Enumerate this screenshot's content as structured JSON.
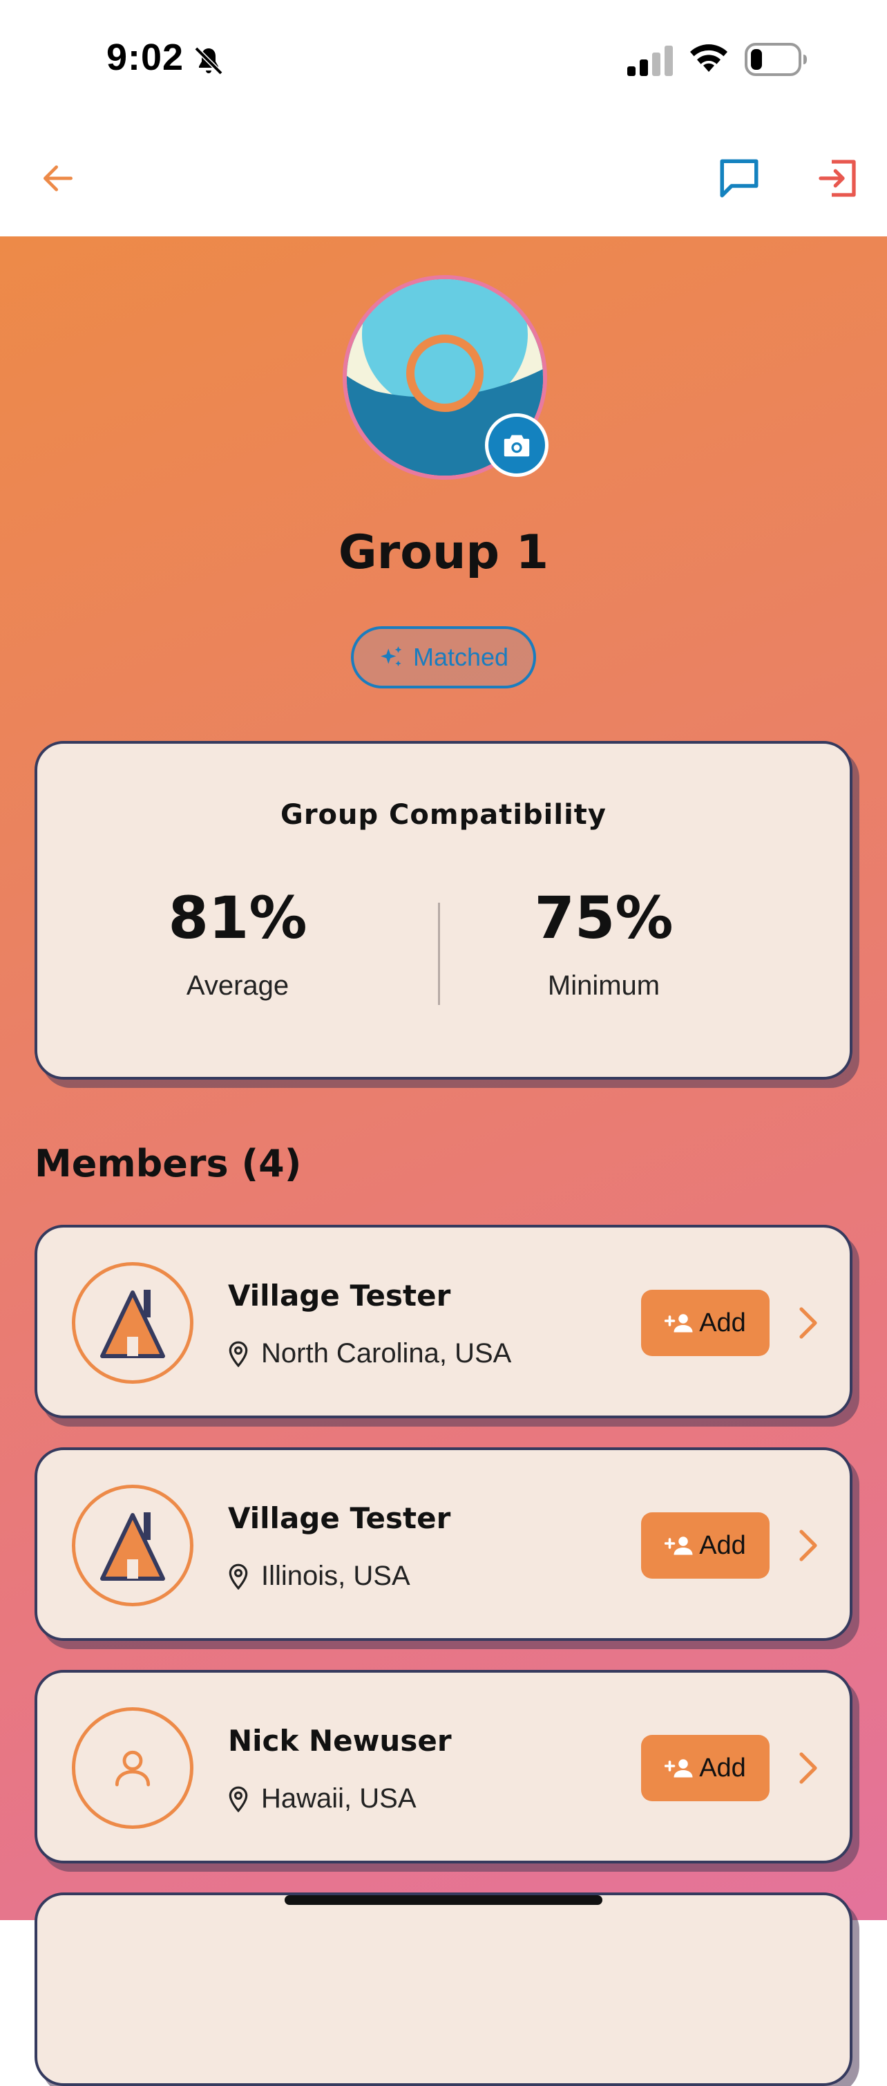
{
  "status_bar": {
    "time": "9:02",
    "icons": [
      "bell-slash-icon",
      "cellular-signal-icon",
      "wifi-icon",
      "battery-icon"
    ]
  },
  "nav": {
    "back_icon": "arrow-left-icon",
    "chat_icon": "chat-bubble-icon",
    "exit_icon": "exit-icon"
  },
  "group": {
    "name": "Group 1",
    "badge_label": "Matched",
    "badge_icon": "sparkles-icon",
    "camera_icon": "camera-icon"
  },
  "compatibility": {
    "title": "Group Compatibility",
    "average_value": "81%",
    "average_label": "Average",
    "minimum_value": "75%",
    "minimum_label": "Minimum"
  },
  "members": {
    "title": "Members (4)",
    "add_label": "Add",
    "items": [
      {
        "name": "Village Tester",
        "location": "North Carolina, USA",
        "avatar": "house-logo-icon"
      },
      {
        "name": "Village Tester",
        "location": "Illinois, USA",
        "avatar": "house-logo-icon"
      },
      {
        "name": "Nick Newuser",
        "location": "Hawaii, USA",
        "avatar": "person-icon"
      }
    ]
  },
  "colors": {
    "accent_orange": "#ed8a48",
    "accent_blue": "#1482bf",
    "exit_red": "#e8584f",
    "card_bg": "#f5e8df",
    "card_border": "#353a5e"
  }
}
